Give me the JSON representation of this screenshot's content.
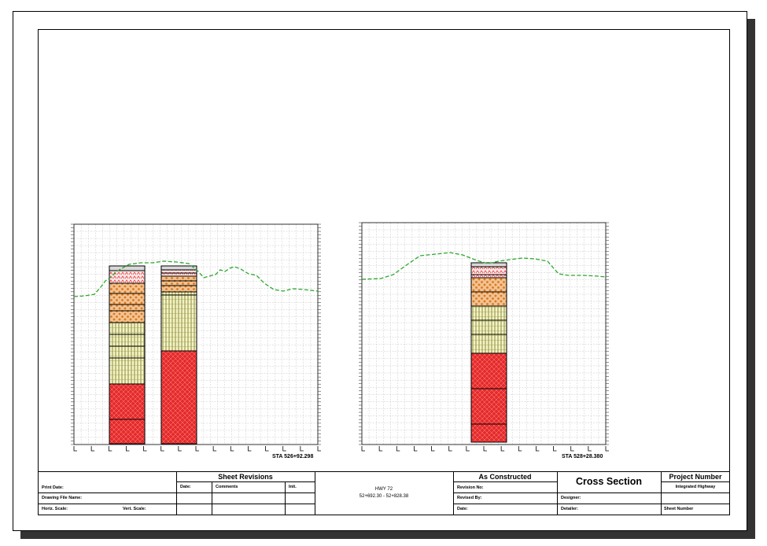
{
  "stations": {
    "left": "STA 526+92.298",
    "right": "STA 528+28.380"
  },
  "title_block": {
    "print_date": "Print Date:",
    "drawing_file_name": "Drawing File Name:",
    "horiz_scale": "Horiz. Scale:",
    "vert_scale": "Vert. Scale:",
    "sheet_revisions": "Sheet Revisions",
    "rev_date": "Date:",
    "rev_comments": "Comments",
    "rev_init": "Init.",
    "hwy": "HWY 72",
    "station_range": "52+692.30 - 52+828.38",
    "as_constructed": "As Constructed",
    "revision_no": "Revision No:",
    "revised_by": "Revised By:",
    "ac_date": "Date:",
    "cross_section": "Cross Section",
    "designer": "Designer:",
    "detailer": "Detailer:",
    "project_number": "Project Number",
    "integrated_highway": "Integrated Highway",
    "sheet_number": "Sheet Number"
  },
  "colors": {
    "ground_line": "#2ea82e",
    "asphalt": "#d8d8d8",
    "gravel": "#f2c291",
    "gravel_dots": "#d9781e",
    "silt": "#f3f3c4",
    "silt_lines": "#7a7a2a",
    "clay": "#e52b2b",
    "border": "#000000",
    "grid": "#c8c8c8"
  }
}
